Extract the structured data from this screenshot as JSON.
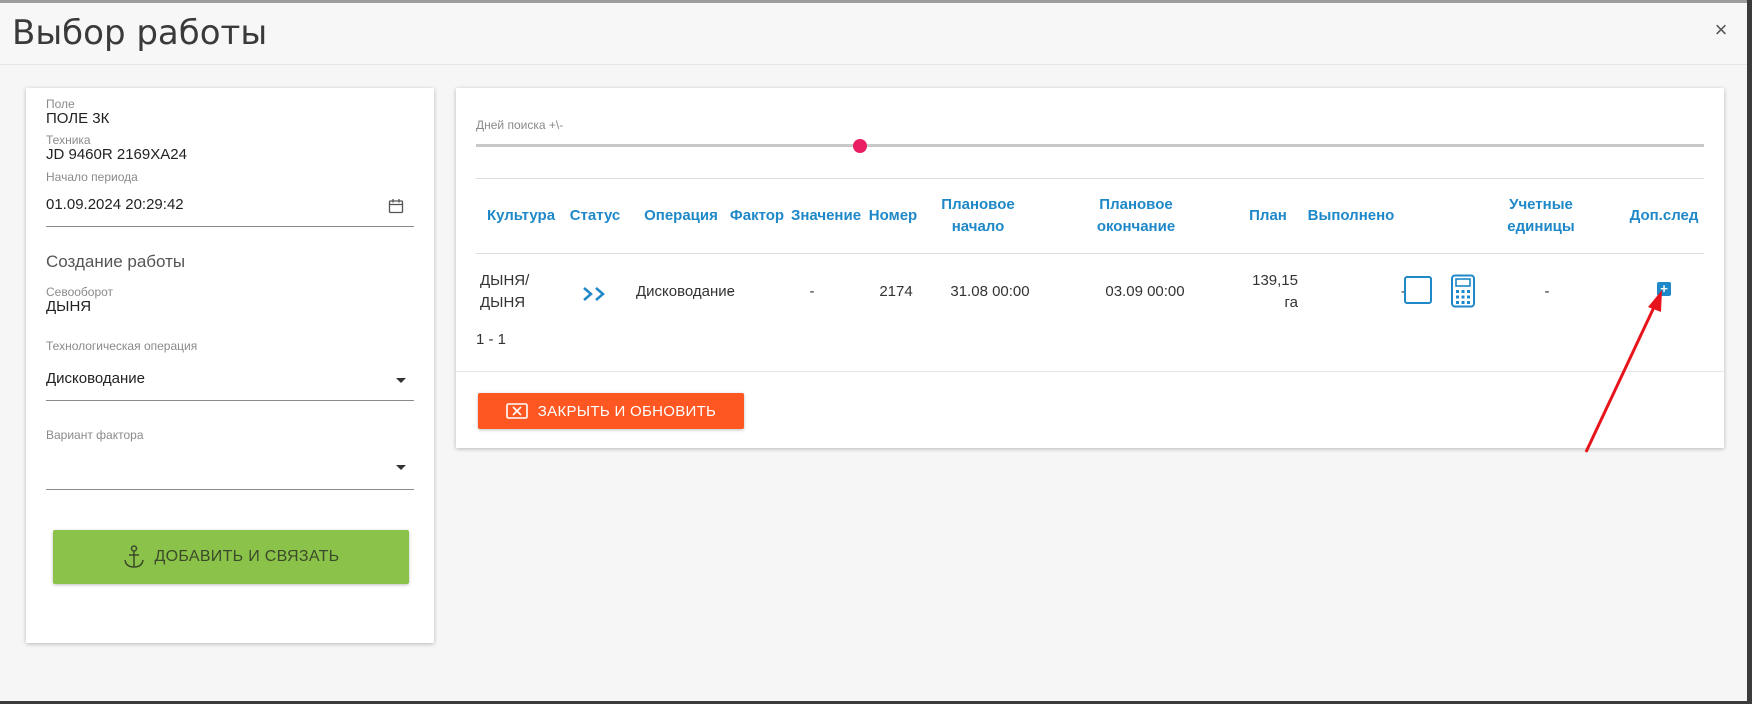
{
  "dialog": {
    "title": "Выбор работы",
    "close_symbol": "×"
  },
  "left": {
    "field_label": "Поле",
    "field_value": "ПОЛЕ 3К",
    "machine_label": "Техника",
    "machine_value": "JD 9460R 2169ХА24",
    "period_label": "Начало периода",
    "period_value": "01.09.2024 20:29:42",
    "create_title": "Создание работы",
    "rotation_label": "Севооборот",
    "rotation_value": "ДЫНЯ",
    "operation_label": "Технологическая операция",
    "operation_value": "Дисководание",
    "factor_label": "Вариант фактора",
    "factor_value": "",
    "add_button": "ДОБАВИТЬ И СВЯЗАТЬ"
  },
  "right": {
    "slider_label": "Дней поиска +\\-",
    "slider_value_fraction": 0.28,
    "columns": [
      "Культура",
      "Статус",
      "Операция",
      "Фактор",
      "Значение",
      "Номер",
      "Плановое начало",
      "Плановое окончание",
      "План",
      "Выполнено",
      "Учетные единицы",
      "Доп.след"
    ],
    "rows": [
      {
        "culture": "ДЫНЯ/ ДЫНЯ",
        "status_icon": "double-chevron-right-icon",
        "operation": "Дисководание",
        "factor": "-",
        "value": "-",
        "number": "2174",
        "plan_start": "31.08 00:00",
        "plan_end": "03.09 00:00",
        "plan": "139,15 га",
        "done": "-",
        "units": "-"
      }
    ],
    "pager": "1 - 1",
    "close_button": "ЗАКРЫТЬ И ОБНОВИТЬ"
  },
  "colors": {
    "accent": "#1e88c8",
    "add_button": "#8bc34a",
    "close_button": "#ff5722",
    "slider_thumb": "#e91e63",
    "arrow": "#e8141b"
  }
}
